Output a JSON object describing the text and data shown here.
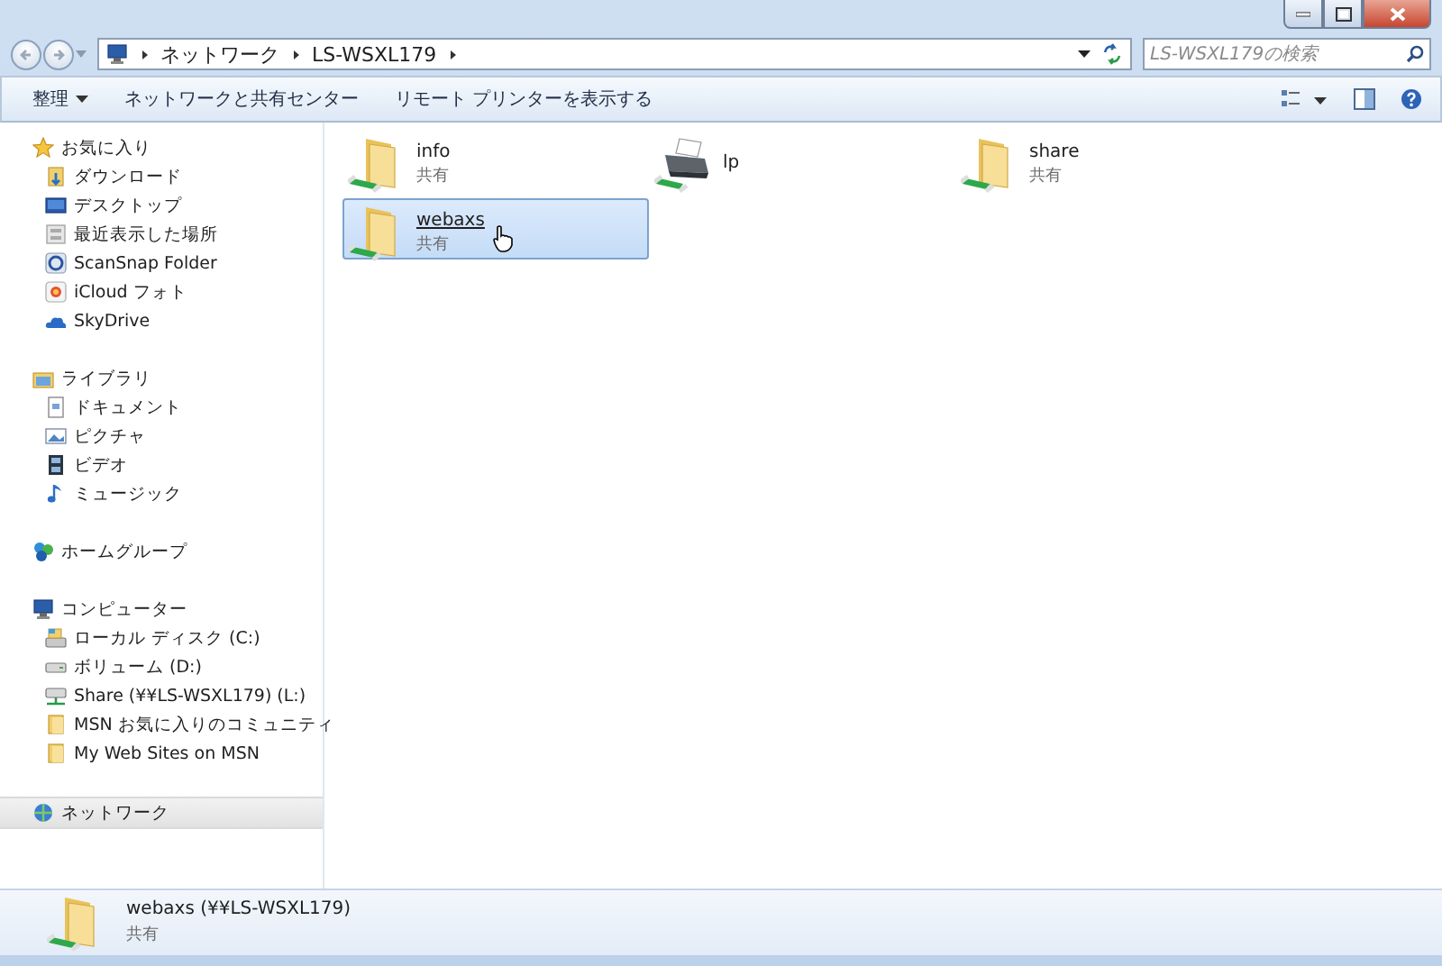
{
  "address": {
    "crumbs": [
      "ネットワーク",
      "LS-WSXL179"
    ]
  },
  "search": {
    "placeholder": "LS-WSXL179の検索"
  },
  "toolbar": {
    "items": [
      {
        "label": "整理",
        "kind": "menu"
      },
      {
        "label": "ネットワークと共有センター",
        "kind": "button"
      },
      {
        "label": "リモート プリンターを表示する",
        "kind": "button"
      }
    ]
  },
  "sidebar": {
    "groups": [
      {
        "label": "お気に入り",
        "selected": false,
        "children": [
          {
            "label": "ダウンロード",
            "selected": false
          },
          {
            "label": "デスクトップ",
            "selected": false
          },
          {
            "label": "最近表示した場所",
            "selected": false
          },
          {
            "label": "ScanSnap Folder",
            "selected": false
          },
          {
            "label": "iCloud フォト",
            "selected": false
          },
          {
            "label": "SkyDrive",
            "selected": false
          }
        ]
      },
      {
        "label": "ライブラリ",
        "selected": false,
        "children": [
          {
            "label": "ドキュメント",
            "selected": false
          },
          {
            "label": "ピクチャ",
            "selected": false
          },
          {
            "label": "ビデオ",
            "selected": false
          },
          {
            "label": "ミュージック",
            "selected": false
          }
        ]
      },
      {
        "label": "ホームグループ",
        "selected": false
      },
      {
        "label": "コンピューター",
        "selected": false,
        "children": [
          {
            "label": "ローカル ディスク (C:)",
            "selected": false
          },
          {
            "label": "ボリューム (D:)",
            "selected": false
          },
          {
            "label": "Share (¥¥LS-WSXL179) (L:)",
            "selected": false
          },
          {
            "label": "MSN お気に入りのコミュニティ",
            "selected": false
          },
          {
            "label": "My Web Sites on MSN",
            "selected": false
          }
        ]
      },
      {
        "label": "ネットワーク",
        "selected": true
      }
    ]
  },
  "items": [
    {
      "kind": "folder",
      "name": "info",
      "subtitle": "共有",
      "selected": false,
      "hovered": false
    },
    {
      "kind": "printer",
      "name": "lp",
      "selected": false,
      "hovered": false
    },
    {
      "kind": "folder",
      "name": "share",
      "subtitle": "共有",
      "selected": false,
      "hovered": false
    },
    {
      "kind": "folder",
      "name": "webaxs",
      "subtitle": "共有",
      "selected": true,
      "hovered": true
    }
  ],
  "details": {
    "title": "webaxs (¥¥LS-WSXL179)",
    "subtitle": "共有"
  }
}
